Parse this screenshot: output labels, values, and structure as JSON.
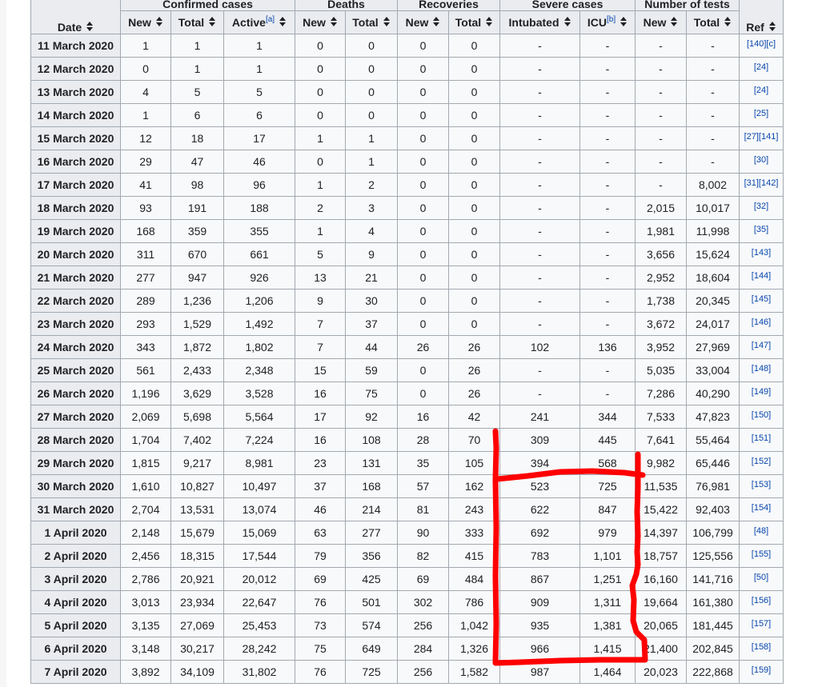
{
  "table": {
    "headers": {
      "date": "Date",
      "groups": [
        "Confirmed cases",
        "Deaths",
        "Recoveries",
        "Severe cases",
        "Number of tests"
      ],
      "ref": "Ref",
      "sub": [
        "New",
        "Total",
        "Active",
        "New",
        "Total",
        "New",
        "Total",
        "Intubated",
        "ICU",
        "New",
        "Total"
      ],
      "active_note": "[a]",
      "icu_note": "[b]"
    },
    "rows": [
      {
        "date": "11 March 2020",
        "cells": [
          "1",
          "1",
          "1",
          "0",
          "0",
          "0",
          "0",
          "-",
          "-",
          "-",
          "-"
        ],
        "ref": "[140][c]"
      },
      {
        "date": "12 March 2020",
        "cells": [
          "0",
          "1",
          "1",
          "0",
          "0",
          "0",
          "0",
          "-",
          "-",
          "-",
          "-"
        ],
        "ref": "[24]"
      },
      {
        "date": "13 March 2020",
        "cells": [
          "4",
          "5",
          "5",
          "0",
          "0",
          "0",
          "0",
          "-",
          "-",
          "-",
          "-"
        ],
        "ref": "[24]"
      },
      {
        "date": "14 March 2020",
        "cells": [
          "1",
          "6",
          "6",
          "0",
          "0",
          "0",
          "0",
          "-",
          "-",
          "-",
          "-"
        ],
        "ref": "[25]"
      },
      {
        "date": "15 March 2020",
        "cells": [
          "12",
          "18",
          "17",
          "1",
          "1",
          "0",
          "0",
          "-",
          "-",
          "-",
          "-"
        ],
        "ref": "[27][141]"
      },
      {
        "date": "16 March 2020",
        "cells": [
          "29",
          "47",
          "46",
          "0",
          "1",
          "0",
          "0",
          "-",
          "-",
          "-",
          "-"
        ],
        "ref": "[30]"
      },
      {
        "date": "17 March 2020",
        "cells": [
          "41",
          "98",
          "96",
          "1",
          "2",
          "0",
          "0",
          "-",
          "-",
          "-",
          "8,002"
        ],
        "ref": "[31][142]"
      },
      {
        "date": "18 March 2020",
        "cells": [
          "93",
          "191",
          "188",
          "2",
          "3",
          "0",
          "0",
          "-",
          "-",
          "2,015",
          "10,017"
        ],
        "ref": "[32]"
      },
      {
        "date": "19 March 2020",
        "cells": [
          "168",
          "359",
          "355",
          "1",
          "4",
          "0",
          "0",
          "-",
          "-",
          "1,981",
          "11,998"
        ],
        "ref": "[35]"
      },
      {
        "date": "20 March 2020",
        "cells": [
          "311",
          "670",
          "661",
          "5",
          "9",
          "0",
          "0",
          "-",
          "-",
          "3,656",
          "15,624"
        ],
        "ref": "[143]"
      },
      {
        "date": "21 March 2020",
        "cells": [
          "277",
          "947",
          "926",
          "13",
          "21",
          "0",
          "0",
          "-",
          "-",
          "2,952",
          "18,604"
        ],
        "ref": "[144]"
      },
      {
        "date": "22 March 2020",
        "cells": [
          "289",
          "1,236",
          "1,206",
          "9",
          "30",
          "0",
          "0",
          "-",
          "-",
          "1,738",
          "20,345"
        ],
        "ref": "[145]"
      },
      {
        "date": "23 March 2020",
        "cells": [
          "293",
          "1,529",
          "1,492",
          "7",
          "37",
          "0",
          "0",
          "-",
          "-",
          "3,672",
          "24,017"
        ],
        "ref": "[146]"
      },
      {
        "date": "24 March 2020",
        "cells": [
          "343",
          "1,872",
          "1,802",
          "7",
          "44",
          "26",
          "26",
          "102",
          "136",
          "3,952",
          "27,969"
        ],
        "ref": "[147]"
      },
      {
        "date": "25 March 2020",
        "cells": [
          "561",
          "2,433",
          "2,348",
          "15",
          "59",
          "0",
          "26",
          "-",
          "-",
          "5,035",
          "33,004"
        ],
        "ref": "[148]"
      },
      {
        "date": "26 March 2020",
        "cells": [
          "1,196",
          "3,629",
          "3,528",
          "16",
          "75",
          "0",
          "26",
          "-",
          "-",
          "7,286",
          "40,290"
        ],
        "ref": "[149]"
      },
      {
        "date": "27 March 2020",
        "cells": [
          "2,069",
          "5,698",
          "5,564",
          "17",
          "92",
          "16",
          "42",
          "241",
          "344",
          "7,533",
          "47,823"
        ],
        "ref": "[150]"
      },
      {
        "date": "28 March 2020",
        "cells": [
          "1,704",
          "7,402",
          "7,224",
          "16",
          "108",
          "28",
          "70",
          "309",
          "445",
          "7,641",
          "55,464"
        ],
        "ref": "[151]"
      },
      {
        "date": "29 March 2020",
        "cells": [
          "1,815",
          "9,217",
          "8,981",
          "23",
          "131",
          "35",
          "105",
          "394",
          "568",
          "9,982",
          "65,446"
        ],
        "ref": "[152]"
      },
      {
        "date": "30 March 2020",
        "cells": [
          "1,610",
          "10,827",
          "10,497",
          "37",
          "168",
          "57",
          "162",
          "523",
          "725",
          "11,535",
          "76,981"
        ],
        "ref": "[153]"
      },
      {
        "date": "31 March 2020",
        "cells": [
          "2,704",
          "13,531",
          "13,074",
          "46",
          "214",
          "81",
          "243",
          "622",
          "847",
          "15,422",
          "92,403"
        ],
        "ref": "[154]"
      },
      {
        "date": "1 April 2020",
        "cells": [
          "2,148",
          "15,679",
          "15,069",
          "63",
          "277",
          "90",
          "333",
          "692",
          "979",
          "14,397",
          "106,799"
        ],
        "ref": "[48]"
      },
      {
        "date": "2 April 2020",
        "cells": [
          "2,456",
          "18,315",
          "17,544",
          "79",
          "356",
          "82",
          "415",
          "783",
          "1,101",
          "18,757",
          "125,556"
        ],
        "ref": "[155]"
      },
      {
        "date": "3 April 2020",
        "cells": [
          "2,786",
          "20,921",
          "20,012",
          "69",
          "425",
          "69",
          "484",
          "867",
          "1,251",
          "16,160",
          "141,716"
        ],
        "ref": "[50]"
      },
      {
        "date": "4 April 2020",
        "cells": [
          "3,013",
          "23,934",
          "22,647",
          "76",
          "501",
          "302",
          "786",
          "909",
          "1,311",
          "19,664",
          "161,380"
        ],
        "ref": "[156]"
      },
      {
        "date": "5 April 2020",
        "cells": [
          "3,135",
          "27,069",
          "25,453",
          "73",
          "574",
          "256",
          "1,042",
          "935",
          "1,381",
          "20,065",
          "181,445"
        ],
        "ref": "[157]"
      },
      {
        "date": "6 April 2020",
        "cells": [
          "3,148",
          "30,217",
          "28,242",
          "75",
          "649",
          "284",
          "1,326",
          "966",
          "1,415",
          "21,400",
          "202,845"
        ],
        "ref": "[158]"
      },
      {
        "date": "7 April 2020",
        "cells": [
          "3,892",
          "34,109",
          "31,802",
          "76",
          "725",
          "256",
          "1,582",
          "987",
          "1,464",
          "20,023",
          "222,868"
        ],
        "ref": "[159]"
      }
    ]
  },
  "annotation": {
    "color": "#ff0000",
    "shape": "hand-drawn freehand rectangle"
  },
  "colors": {
    "header_bg": "#eaecf0",
    "cell_bg": "#f8f9fa",
    "border": "#a2a9b1",
    "link": "#0645ad"
  }
}
